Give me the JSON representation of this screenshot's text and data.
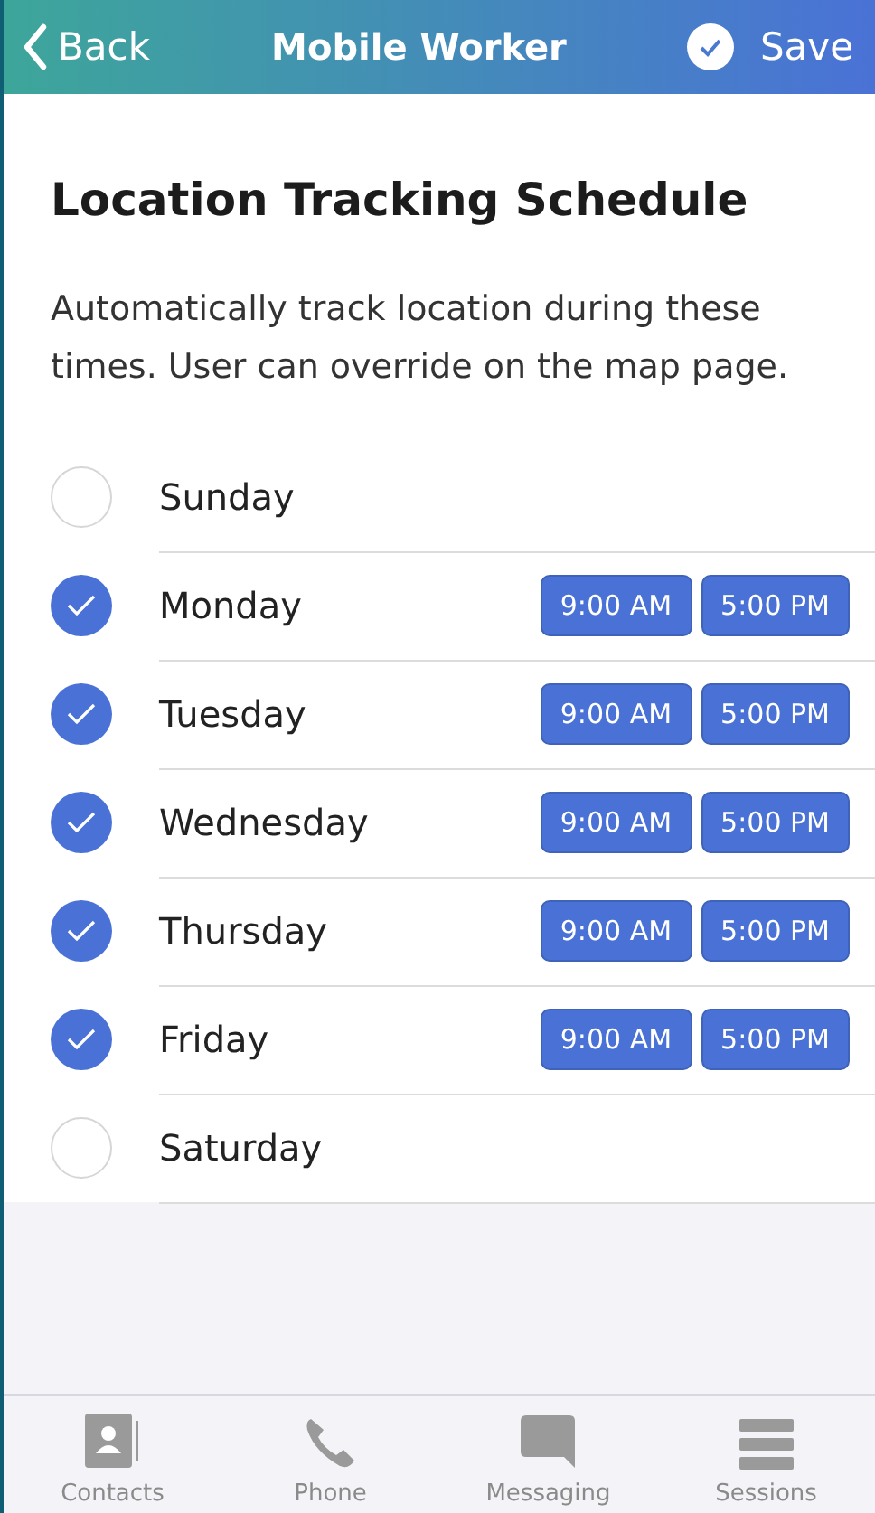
{
  "header": {
    "back": "Back",
    "title": "Mobile Worker",
    "save": "Save"
  },
  "heading": "Location Tracking Schedule",
  "description": "Automatically track location during these times. User can override on the map page.",
  "days": [
    {
      "name": "Sunday",
      "checked": false
    },
    {
      "name": "Monday",
      "checked": true,
      "start": "9:00 AM",
      "end": "5:00 PM"
    },
    {
      "name": "Tuesday",
      "checked": true,
      "start": "9:00 AM",
      "end": "5:00 PM"
    },
    {
      "name": "Wednesday",
      "checked": true,
      "start": "9:00 AM",
      "end": "5:00 PM"
    },
    {
      "name": "Thursday",
      "checked": true,
      "start": "9:00 AM",
      "end": "5:00 PM"
    },
    {
      "name": "Friday",
      "checked": true,
      "start": "9:00 AM",
      "end": "5:00 PM"
    },
    {
      "name": "Saturday",
      "checked": false
    }
  ],
  "tab_bar": [
    {
      "label": "Contacts",
      "kind": "contacts"
    },
    {
      "label": "Phone",
      "kind": "phone"
    },
    {
      "label": "Messaging",
      "kind": "messaging"
    },
    {
      "label": "Sessions",
      "kind": "sessions"
    }
  ]
}
